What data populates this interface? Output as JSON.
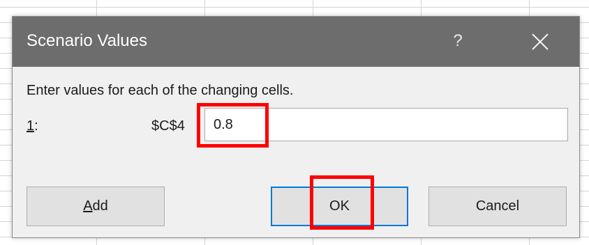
{
  "dialog": {
    "title": "Scenario Values",
    "help_label": "?",
    "prompt": "Enter values for each of the changing cells.",
    "rows": [
      {
        "index": "1",
        "index_suffix": ":",
        "cell_ref": "$C$4",
        "value": "0.8"
      }
    ],
    "buttons": {
      "add": "Add",
      "ok": "OK",
      "cancel": "Cancel"
    }
  },
  "icons": {
    "close": "close-icon"
  },
  "colors": {
    "titlebar": "#6d6d6d",
    "dialog_bg": "#f0f0f0",
    "default_button_border": "#0078d7",
    "highlight": "#ff0000"
  }
}
